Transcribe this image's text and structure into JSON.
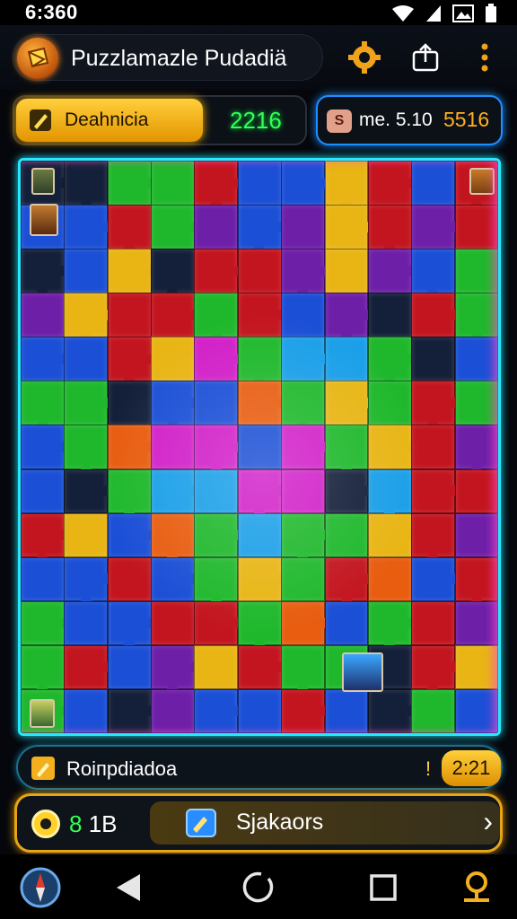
{
  "status_bar": {
    "time": "6:360",
    "icons": [
      "wifi-icon",
      "signal-icon",
      "image-icon",
      "battery-icon"
    ]
  },
  "header": {
    "title": "Puzzlamazle Pudadiä",
    "logo_icon": "app-logo-icon",
    "actions": [
      "gear-icon",
      "share-icon",
      "more-vert-icon"
    ]
  },
  "stats": {
    "level_label": "Deahnicia",
    "level_value": "2216",
    "score_badge": "S",
    "score_label": "me. 5.10",
    "score_value": "5516"
  },
  "hint": {
    "label": "Roiпрdiadoa",
    "separator": "!",
    "count": "2:21"
  },
  "actions": {
    "coins_green": "8",
    "coins_value": "1B",
    "action_label": "Sjakaors",
    "arrow": "›"
  },
  "colors": {
    "red": "#c3151f",
    "green": "#1fb82c",
    "blue": "#1b4fd6",
    "yellow": "#e8b514",
    "purple": "#6e1fa8",
    "magenta": "#d11fc8",
    "cyan": "#1a9fe8",
    "orange": "#e85d10",
    "dark": "#14203a",
    "neon_cyan": "#25e9ff",
    "neon_gold": "#e6a516"
  },
  "board": {
    "columns": 11,
    "rows": 13,
    "cell_colors": [
      "dark",
      "dark",
      "green",
      "green",
      "red",
      "blue",
      "blue",
      "yellow",
      "red",
      "blue",
      "red",
      "blue",
      "blue",
      "red",
      "green",
      "purple",
      "blue",
      "purple",
      "yellow",
      "red",
      "purple",
      "red",
      "dark",
      "blue",
      "yellow",
      "dark",
      "red",
      "red",
      "purple",
      "yellow",
      "purple",
      "blue",
      "green",
      "purple",
      "yellow",
      "red",
      "red",
      "green",
      "red",
      "blue",
      "purple",
      "dark",
      "red",
      "green",
      "blue",
      "blue",
      "red",
      "yellow",
      "magenta",
      "green",
      "cyan",
      "cyan",
      "green",
      "dark",
      "blue",
      "green",
      "green",
      "dark",
      "blue",
      "blue",
      "orange",
      "green",
      "yellow",
      "green",
      "red",
      "green",
      "blue",
      "green",
      "orange",
      "magenta",
      "magenta",
      "blue",
      "magenta",
      "green",
      "yellow",
      "red",
      "purple",
      "blue",
      "dark",
      "green",
      "cyan",
      "cyan",
      "magenta",
      "magenta",
      "dark",
      "cyan",
      "red",
      "red",
      "red",
      "yellow",
      "blue",
      "orange",
      "green",
      "cyan",
      "green",
      "green",
      "yellow",
      "red",
      "purple",
      "blue",
      "blue",
      "red",
      "blue",
      "green",
      "yellow",
      "green",
      "red",
      "orange",
      "blue",
      "red",
      "green",
      "blue",
      "blue",
      "red",
      "red",
      "green",
      "orange",
      "blue",
      "green",
      "red",
      "purple",
      "green",
      "red",
      "blue",
      "purple",
      "yellow",
      "red",
      "green",
      "green",
      "dark",
      "red",
      "yellow",
      "green",
      "blue",
      "dark",
      "purple",
      "blue",
      "blue",
      "red",
      "blue",
      "dark",
      "green",
      "blue"
    ]
  }
}
